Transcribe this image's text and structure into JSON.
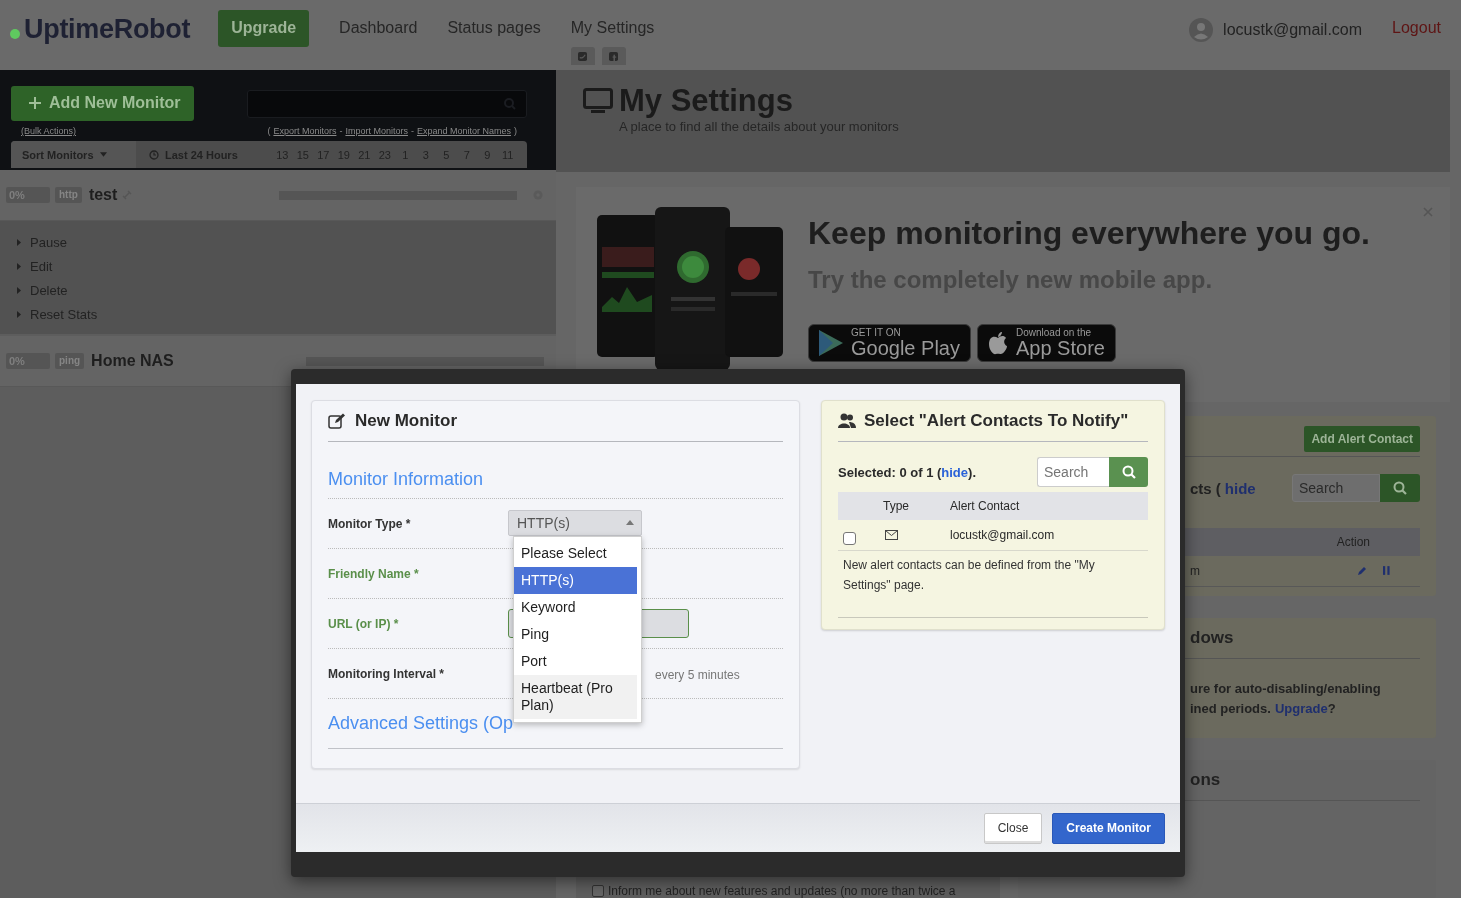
{
  "header": {
    "logo": "UptimeRobot",
    "upgrade": "Upgrade",
    "nav": [
      {
        "label": "Dashboard"
      },
      {
        "label": "Status pages"
      },
      {
        "label": "My Settings",
        "tabs": [
          {
            "kind": "twitter"
          },
          {
            "kind": "facebook"
          }
        ]
      }
    ],
    "user": "locustk@gmail.com",
    "logout": "Logout"
  },
  "sidebar": {
    "add_button": "Add New Monitor",
    "bulk_actions": "(Bulk Actions)",
    "link_open": "(",
    "link_sep": "-",
    "link_close": ")",
    "links": [
      "Export Monitors",
      "Import Monitors",
      "Expand Monitor Names"
    ],
    "sort": "Sort Monitors",
    "range": "Last 24 Hours",
    "hours": [
      "13",
      "15",
      "17",
      "19",
      "21",
      "23",
      "1",
      "3",
      "5",
      "7",
      "9",
      "11"
    ],
    "monitors": [
      {
        "uptime": "0%",
        "type": "http",
        "name": "test",
        "expanded": true,
        "actions": [
          "Pause",
          "Edit",
          "Delete",
          "Reset Stats"
        ]
      },
      {
        "uptime": "0%",
        "type": "ping",
        "name": "Home NAS",
        "expanded": false
      }
    ]
  },
  "page": {
    "title": "My Settings",
    "subtitle": "A place to find all the details about your monitors"
  },
  "promo": {
    "headline": "Keep monitoring everywhere you go.",
    "subline": "Try the completely new mobile app.",
    "badges": [
      {
        "kind": "google",
        "small": "GET IT ON",
        "big": "Google Play"
      },
      {
        "kind": "apple",
        "small": "Download on the",
        "big": "App Store"
      }
    ]
  },
  "alert_card": {
    "add_button": "Add Alert Contact",
    "title_fragment": "cts (",
    "hide": "hide",
    "search_placeholder": "Search",
    "column": "Action",
    "row_fragment": "m"
  },
  "windows_card": {
    "title_fragment": "dows",
    "line_1": "ure for auto-disabling/enabling",
    "line_2": "ined periods.",
    "upgrade": "Upgrade",
    "end": "?"
  },
  "third_card": {
    "title_fragment": "ons"
  },
  "newsletter": {
    "checked": false,
    "label": "Inform me about new features and updates (no more than twice a"
  },
  "modal": {
    "new_monitor": {
      "title": "New Monitor",
      "section": "Monitor Information",
      "fields": [
        {
          "kind": "select",
          "label": "Monitor Type *",
          "valid": false,
          "value": "HTTP(s)",
          "open": true,
          "options": [
            {
              "label": "Please Select",
              "selected": false,
              "highlighted": false
            },
            {
              "label": "HTTP(s)",
              "selected": true,
              "highlighted": false
            },
            {
              "label": "Keyword",
              "selected": false,
              "highlighted": false
            },
            {
              "label": "Ping",
              "selected": false,
              "highlighted": false
            },
            {
              "label": "Port",
              "selected": false,
              "highlighted": false
            },
            {
              "label": "Heartbeat (Pro Plan)",
              "selected": false,
              "highlighted": true
            }
          ]
        },
        {
          "kind": "hidden",
          "label": "Friendly Name *",
          "valid": true
        },
        {
          "kind": "input",
          "label": "URL (or IP) *",
          "valid": true
        },
        {
          "kind": "interval",
          "label": "Monitoring Interval *",
          "valid": false,
          "reading": "every 5 minutes"
        }
      ],
      "advanced": "Advanced Settings (Op"
    },
    "alerts": {
      "title": "Select \"Alert Contacts To Notify\"",
      "selected_text": "Selected: 0 of 1 (",
      "hide": "hide",
      "selected_end": ").",
      "search_placeholder": "Search",
      "columns": [
        "Type",
        "Alert Contact"
      ],
      "contacts": [
        {
          "checked": false,
          "email": "locustk@gmail.com"
        }
      ],
      "note": "New alert contacts can be defined from the \"My Settings\" page."
    },
    "buttons": [
      {
        "kind": "default",
        "label": "Close"
      },
      {
        "kind": "primary",
        "label": "Create Monitor"
      }
    ]
  }
}
